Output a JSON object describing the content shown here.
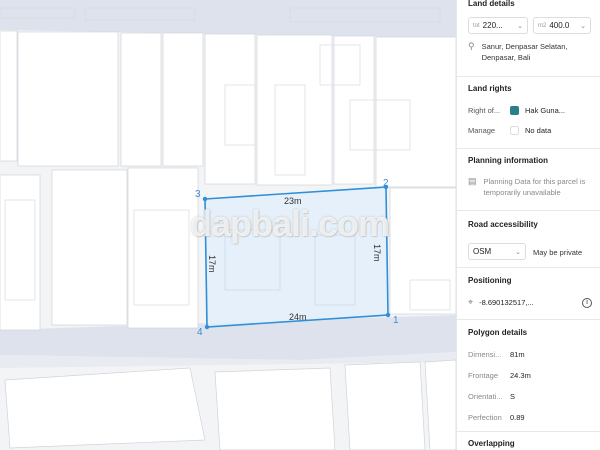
{
  "map": {
    "watermark": "dapbali.com",
    "parcel": {
      "edges": {
        "top": "23m",
        "bottom": "24m",
        "left": "17m",
        "right": "17m"
      },
      "vertices": [
        "1",
        "2",
        "3",
        "4"
      ]
    },
    "colors": {
      "parcel_stroke": "#2f8fd8",
      "parcel_fill": "#e2eefa",
      "road": "#dde2ec",
      "building": "#ffffff"
    }
  },
  "panel": {
    "land_details": {
      "title": "Land details",
      "size_total": {
        "unit": "tot",
        "value": "220...",
        "chevron": "chevron-down-icon"
      },
      "size_area": {
        "unit": "m2",
        "value": "400.0",
        "chevron": "chevron-down-icon"
      },
      "location": "Sanur, Denpasar Selatan, Denpasar, Bali"
    },
    "land_rights": {
      "title": "Land rights",
      "rows": [
        {
          "label": "Right of...",
          "value": "Hak Guna...",
          "swatch": "#2a7f8c"
        },
        {
          "label": "Manage",
          "value": "No data",
          "swatch": "#ffffff"
        }
      ]
    },
    "planning": {
      "title": "Planning information",
      "message": "Planning Data for this parcel is temporarily unavailable"
    },
    "road": {
      "title": "Road accessibility",
      "select_value": "OSM",
      "note": "May be private"
    },
    "positioning": {
      "title": "Positioning",
      "coordinate": "-8.690132517,..."
    },
    "polygon": {
      "title": "Polygon details",
      "rows": [
        {
          "label": "Dimensi...",
          "value": "81m"
        },
        {
          "label": "Frontage",
          "value": "24.3m"
        },
        {
          "label": "Orientati...",
          "value": "S"
        },
        {
          "label": "Perfection",
          "value": "0.89"
        }
      ]
    },
    "overlapping": {
      "title": "Overlapping"
    }
  }
}
